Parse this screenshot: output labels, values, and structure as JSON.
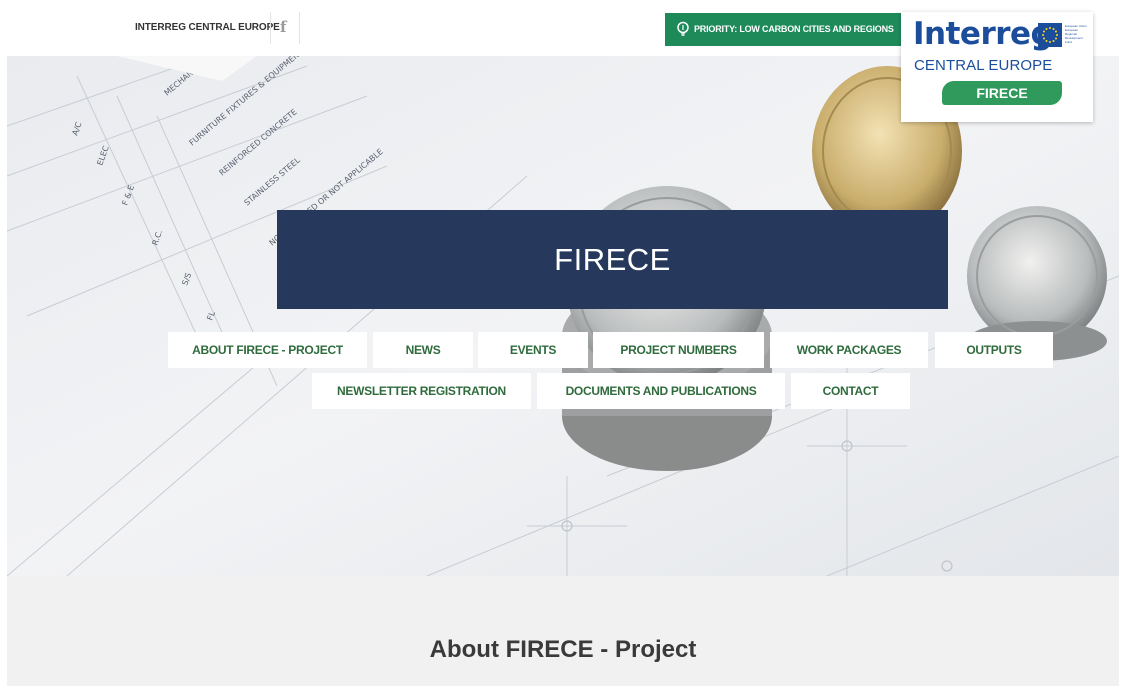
{
  "topbar": {
    "program_link": "INTERREG CENTRAL EUROPE",
    "facebook_icon": "facebook-icon",
    "priority_icon": "lightbulb-icon",
    "priority_label": "PRIORITY: LOW CARBON CITIES AND REGIONS"
  },
  "logo": {
    "wordmark": "Interreg",
    "subtitle": "CENTRAL EUROPE",
    "project_badge": "FIRECE",
    "eu_text": "European Union European Regional Development Fund"
  },
  "hero": {
    "title": "FIRECE"
  },
  "nav": {
    "row1": [
      "ABOUT FIRECE - PROJECT",
      "NEWS",
      "EVENTS",
      "PROJECT NUMBERS",
      "WORK PACKAGES",
      "OUTPUTS"
    ],
    "row2": [
      "NEWSLETTER REGISTRATION",
      "DOCUMENTS AND PUBLICATIONS",
      "CONTACT"
    ]
  },
  "about": {
    "heading": "About FIRECE - Project"
  },
  "colors": {
    "accent_green": "#1e8a5a",
    "nav_text": "#2f6b3c",
    "title_box": "#26385b",
    "logo_blue": "#1c4d9b"
  }
}
